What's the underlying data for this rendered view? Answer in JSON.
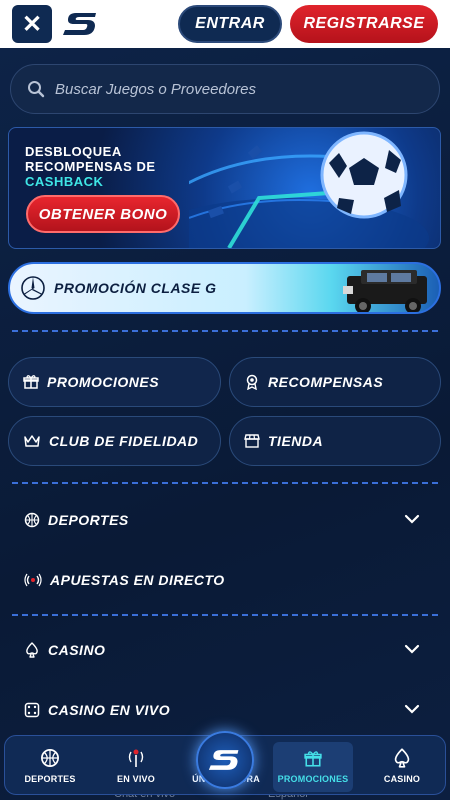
{
  "header": {
    "close_label": "✕",
    "login_label": "ENTRAR",
    "register_label": "REGISTRARSE"
  },
  "search": {
    "placeholder": "Buscar Juegos o Proveedores"
  },
  "promo_banner": {
    "line1": "DESBLOQUEA",
    "line2": "RECOMPENSAS DE",
    "line3": "CASHBACK",
    "button_label": "OBTENER BONO"
  },
  "gclass_banner": {
    "label": "PROMOCIÓN CLASE G"
  },
  "quick_links": [
    {
      "label": "PROMOCIONES",
      "icon": "gift-icon"
    },
    {
      "label": "RECOMPENSAS",
      "icon": "medal-icon"
    },
    {
      "label": "CLUB DE FIDELIDAD",
      "icon": "crown-icon"
    },
    {
      "label": "TIENDA",
      "icon": "store-icon"
    }
  ],
  "nav": [
    {
      "label": "DEPORTES",
      "icon": "basketball-icon",
      "has_chevron": true
    },
    {
      "label": "APUESTAS EN DIRECTO",
      "icon": "live-signal-icon",
      "has_chevron": false
    },
    {
      "label": "CASINO",
      "icon": "spade-icon",
      "has_chevron": true
    },
    {
      "label": "CASINO EN VIVO",
      "icon": "dice-icon",
      "has_chevron": true
    }
  ],
  "bottom_nav": [
    {
      "label": "DEPORTES",
      "icon": "basketball-icon"
    },
    {
      "label": "EN VIVO",
      "icon": "live-signal-icon"
    },
    {
      "label": "ÚNETE AHORA",
      "icon": "logo-s-icon"
    },
    {
      "label": "PROMOCIONES",
      "icon": "gift-icon",
      "active": true
    },
    {
      "label": "CASINO",
      "icon": "spade-icon"
    }
  ],
  "footer_peek": {
    "left": "Chat en vivo",
    "right": "Español"
  },
  "colors": {
    "brand_navy": "#0f2a52",
    "accent_red": "#e0242c",
    "accent_cyan": "#45dfe8",
    "divider_blue": "#3b6fd8"
  }
}
